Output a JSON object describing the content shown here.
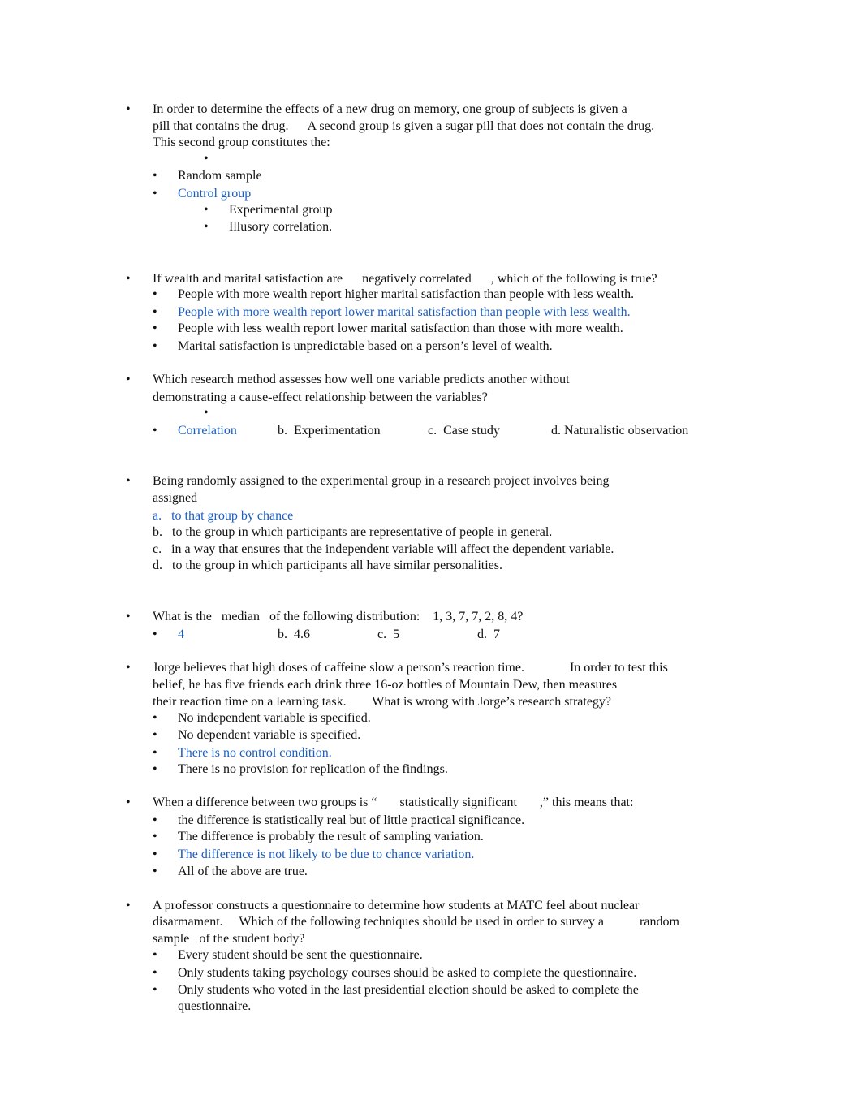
{
  "bullet": "•",
  "questions": [
    {
      "stem": [
        "In order to determine the effects of a new drug on memory, one group of subjects is given a",
        "pill that contains the drug.      A second group is given a sugar pill that does not contain the drug.",
        "This second group constitutes the:"
      ],
      "options": [
        "Random sample",
        "Control group",
        "Experimental group",
        "Illusory correlation."
      ],
      "correct_index": 1
    },
    {
      "stem": [
        "If wealth and marital satisfaction are      negatively correlated      , which of the following is true?"
      ],
      "options": [
        "People with more wealth report higher marital satisfaction than people with less wealth.",
        "People with more wealth report lower marital satisfaction than people with less wealth.",
        "People with less wealth report lower marital satisfaction than those with more wealth.",
        "Marital satisfaction is unpredictable based on a person’s level of wealth."
      ],
      "correct_index": 1
    },
    {
      "stem": [
        "Which research method assesses how well one variable predicts another without",
        "demonstrating a cause-effect relationship between the variables?"
      ],
      "options": [
        "Correlation",
        "b.  Experimentation",
        "c.  Case study",
        "d. Naturalistic observation"
      ],
      "correct_index": 0
    },
    {
      "stem": [
        "Being randomly assigned to the experimental group in a research project involves being",
        "assigned"
      ],
      "options": [
        "a.   to that group by chance",
        "b.   to the group in which participants are representative of people in general.",
        "c.   in a way that ensures that the independent variable will affect the dependent variable.",
        "d.   to the group in which participants all have similar personalities."
      ],
      "correct_index": 0
    },
    {
      "stem": [
        "What is the   median   of the following distribution:    1, 3, 7, 7, 2, 8, 4?"
      ],
      "options": [
        "4",
        "b.  4.6",
        "c.  5",
        "d.  7"
      ],
      "correct_index": 0
    },
    {
      "stem": [
        "Jorge believes that high doses of caffeine slow a person’s reaction time.              In order to test this",
        "belief, he has five friends each drink three 16-oz bottles of Mountain Dew, then measures",
        "their reaction time on a learning task.        What is wrong with Jorge’s research strategy?"
      ],
      "options": [
        "No independent variable is specified.",
        "No dependent variable is specified.",
        "There is no control condition.",
        "There is no provision for replication of the findings."
      ],
      "correct_index": 2
    },
    {
      "stem": [
        "When a difference between two groups is “       statistically significant       ,” this means that:"
      ],
      "options": [
        "the difference is statistically real but of little practical significance.",
        "The difference is probably the result of sampling variation.",
        "The difference is not likely to be due to chance variation.",
        "All of the above are true."
      ],
      "correct_index": 2
    },
    {
      "stem": [
        "A professor constructs a questionnaire to determine how students at MATC feel about nuclear",
        "disarmament.     Which of the following techniques should be used in order to survey a           random",
        "sample   of the student body?"
      ],
      "options": [
        "Every student should be sent the questionnaire.",
        "Only students taking psychology courses should be asked to complete the questionnaire.",
        "Only students who voted in the last presidential election should be asked to complete the",
        "questionnaire."
      ]
    }
  ],
  "colors": {
    "answer": "#1a5dc2",
    "text": "#111111"
  }
}
